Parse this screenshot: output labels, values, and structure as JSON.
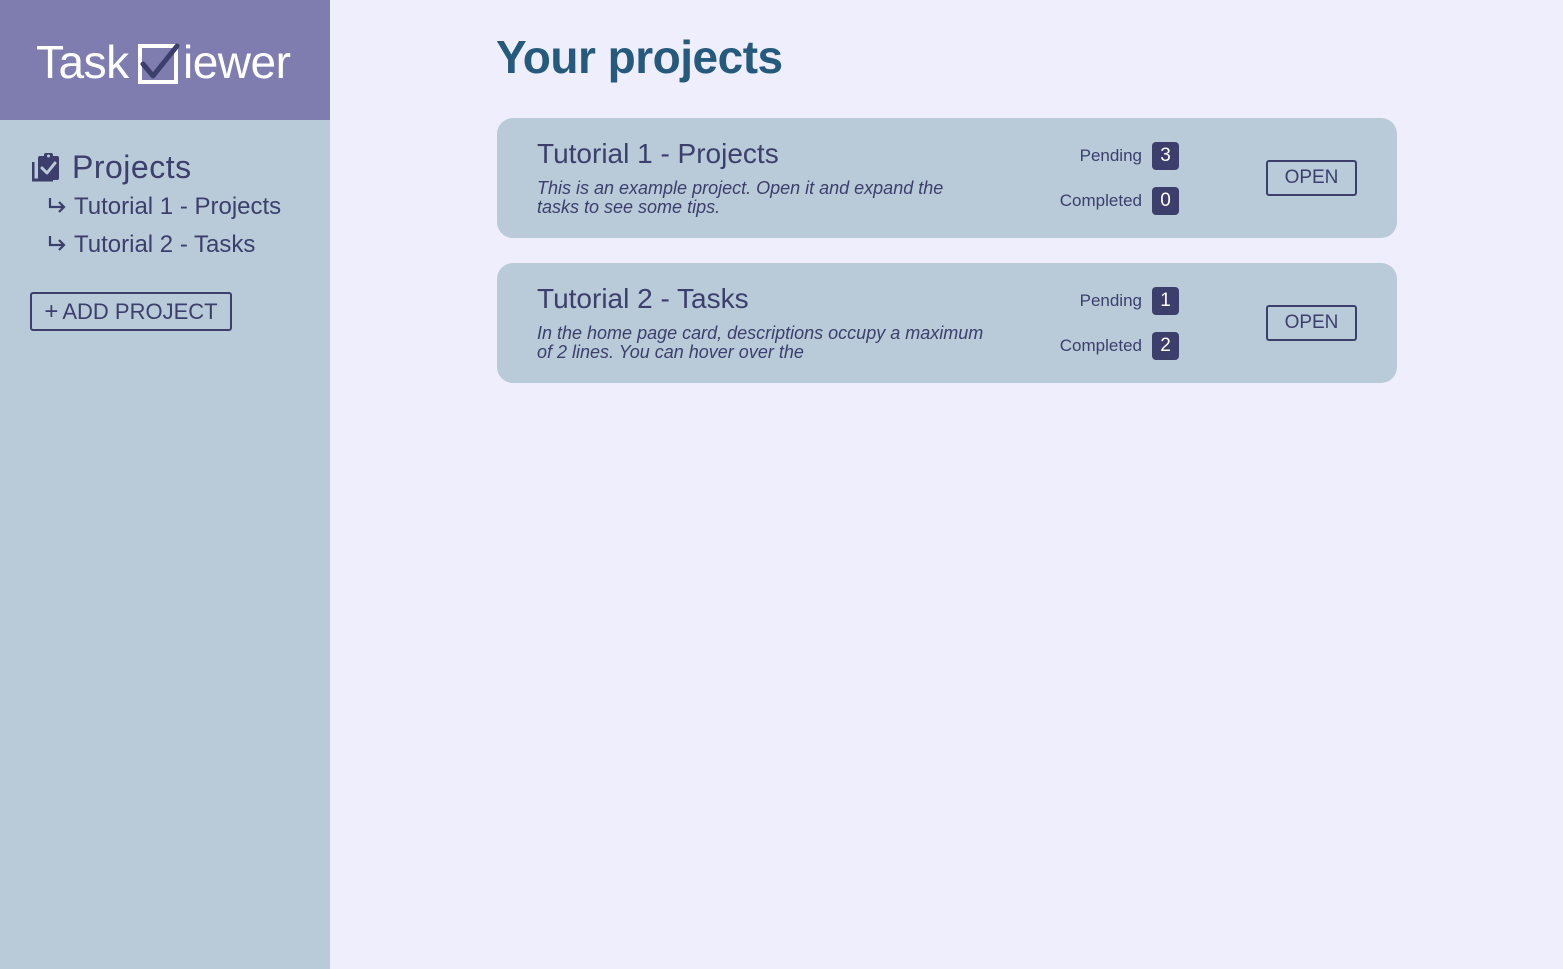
{
  "logo": {
    "prefix": "Task",
    "suffix": "iewer"
  },
  "sidebar": {
    "heading": "Projects",
    "items": [
      {
        "label": "Tutorial 1 - Projects"
      },
      {
        "label": "Tutorial 2 - Tasks"
      }
    ],
    "add_button": {
      "plus": "+",
      "label": "ADD PROJECT"
    }
  },
  "main": {
    "title": "Your projects",
    "cards": [
      {
        "title": "Tutorial 1 - Projects",
        "description": "This is an example project. Open it and expand the tasks to see some tips.",
        "pending_label": "Pending",
        "pending_count": "3",
        "completed_label": "Completed",
        "completed_count": "0",
        "open_label": "OPEN"
      },
      {
        "title": "Tutorial 2 - Tasks",
        "description": "In the home page card, descriptions occupy a maximum of 2 lines. You can hover over the",
        "pending_label": "Pending",
        "pending_count": "1",
        "completed_label": "Completed",
        "completed_count": "2",
        "open_label": "OPEN"
      }
    ]
  },
  "colors": {
    "sidebar_bg": "#b9cad9",
    "logo_bg": "#7f7daf",
    "page_bg": "#efeefc",
    "accent": "#3c3f6b",
    "title": "#265a7c"
  },
  "icons": {
    "logo": "checkbox-check-icon",
    "projects": "clipboard-check-icon",
    "nav_item": "subdirectory-arrow-icon"
  }
}
